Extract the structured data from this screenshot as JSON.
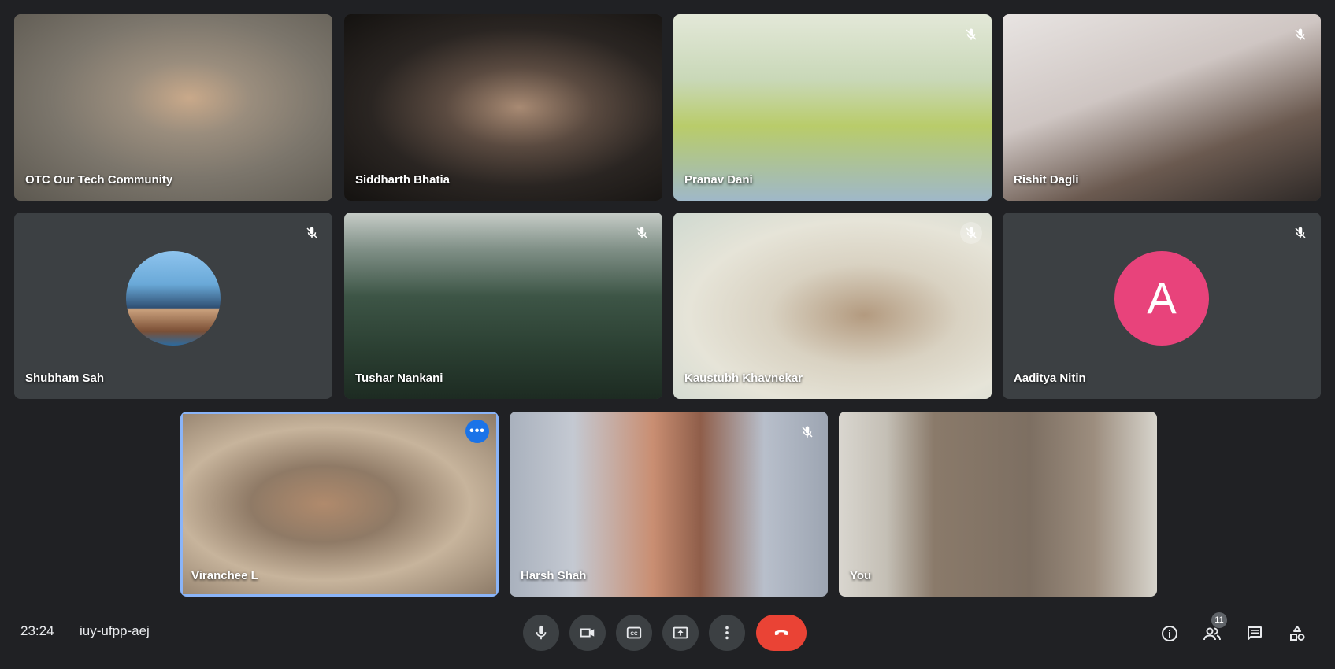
{
  "tiles": [
    {
      "name": "OTC Our Tech Community",
      "muted": false
    },
    {
      "name": "Siddharth Bhatia",
      "muted": false
    },
    {
      "name": "Pranav Dani",
      "muted": true
    },
    {
      "name": "Rishit Dagli",
      "muted": true
    },
    {
      "name": "Shubham Sah",
      "muted": true
    },
    {
      "name": "Tushar Nankani",
      "muted": true
    },
    {
      "name": "Kaustubh Khavnekar",
      "muted": true
    },
    {
      "name": "Aaditya Nitin",
      "muted": true,
      "avatar_letter": "A"
    },
    {
      "name": "Viranchee L",
      "muted": false
    },
    {
      "name": "Harsh Shah",
      "muted": true
    },
    {
      "name": "You",
      "muted": false
    }
  ],
  "footer": {
    "time": "23:24",
    "meeting_code": "iuy-ufpp-aej",
    "participants_count": "11"
  },
  "colors": {
    "background": "#202124",
    "hangup": "#ea4335",
    "active_speaker_border": "#8ab4f8",
    "avatar_letter_bg": "#e8437b"
  }
}
